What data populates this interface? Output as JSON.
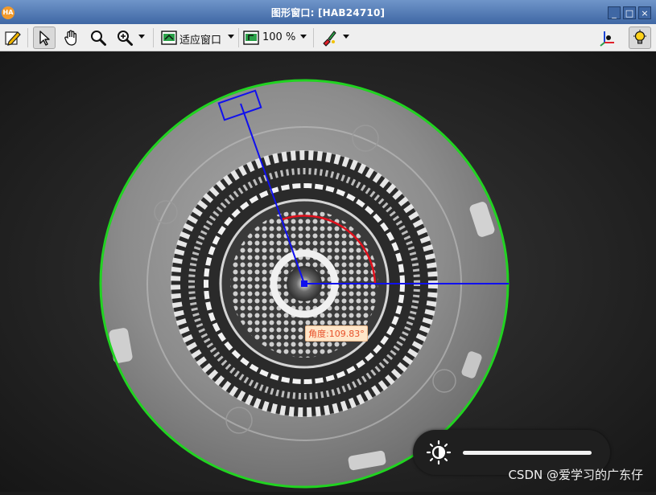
{
  "window": {
    "title": "图形窗口: [HAB24710]",
    "app_logo_text": "HA",
    "minimize_icon": "_",
    "maximize_icon": "□",
    "close_icon": "×"
  },
  "toolbar": {
    "fit_window_label": "适应窗口",
    "zoom_label": "100 %"
  },
  "overlay": {
    "angle_text": "角度:109.83°"
  },
  "watermark": "CSDN @爱学习的广东仔",
  "colors": {
    "circle": "#21d321",
    "measure_line": "#0000ff",
    "arc": "#e0101c",
    "titlebar": "#4f77b3"
  }
}
